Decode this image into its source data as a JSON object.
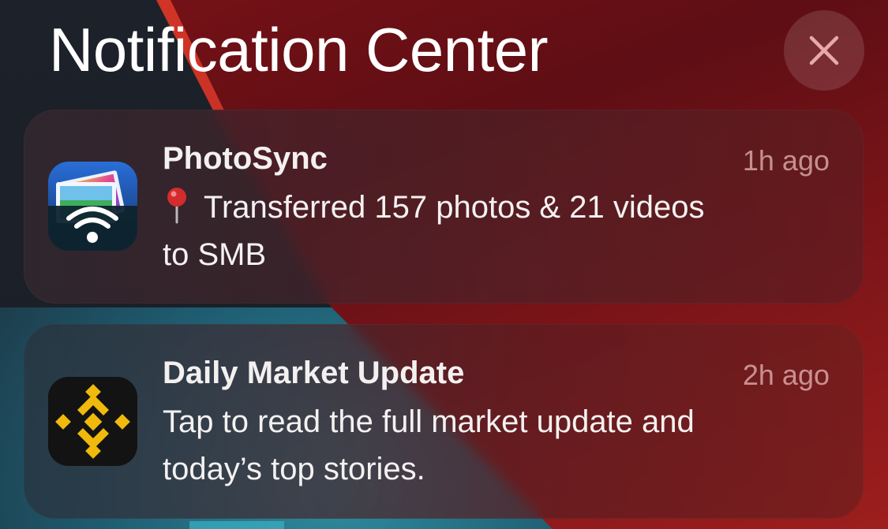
{
  "header": {
    "title": "Notification Center",
    "close_icon": "close-icon"
  },
  "notifications": [
    {
      "app": "PhotoSync",
      "icon": "photosync-app-icon",
      "time": "1h ago",
      "body_prefix_icon": "pin-icon",
      "body_line1": "Transferred 157 photos & 21 videos",
      "body_line2": "to SMB"
    },
    {
      "app": "Daily Market Update",
      "icon": "binance-app-icon",
      "time": "2h ago",
      "body_line1": "Tap to read the full market update and",
      "body_line2": "today’s top stories."
    }
  ],
  "colors": {
    "wallpaper_red": "#7a1217",
    "wallpaper_dark": "#1d2129",
    "wallpaper_teal": "#2f8c9e",
    "binance_yellow": "#f0b90b"
  }
}
